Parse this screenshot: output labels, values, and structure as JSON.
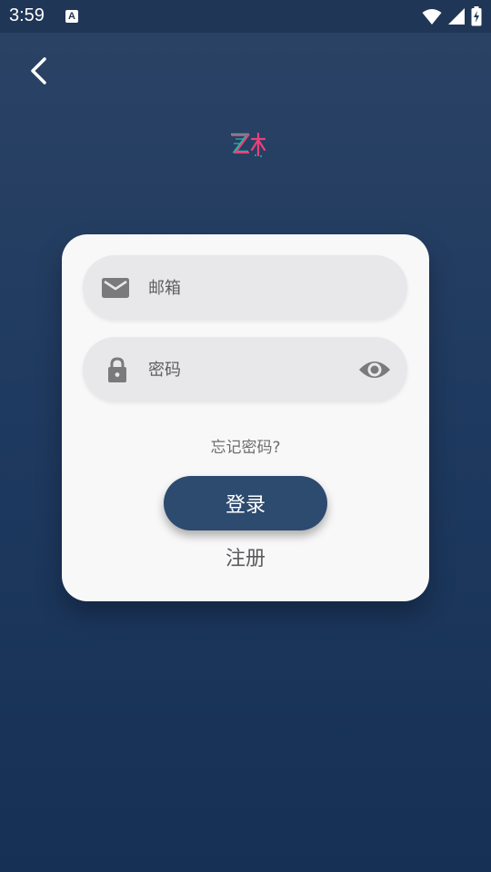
{
  "status_bar": {
    "time": "3:59",
    "notification_badge": "A",
    "icons": [
      "wifi-icon",
      "cellular-signal-icon",
      "battery-charging-icon"
    ]
  },
  "nav": {
    "back_icon": "chevron-left-icon"
  },
  "logo": {
    "colors": [
      "#1fb7a6",
      "#e8417a"
    ]
  },
  "form": {
    "email": {
      "placeholder": "邮箱",
      "value": "",
      "icon": "mail-icon"
    },
    "password": {
      "placeholder": "密码",
      "value": "",
      "icon": "lock-icon",
      "toggle_icon": "eye-icon"
    },
    "forgot_label": "忘记密码?",
    "login_label": "登录",
    "register_label": "注册"
  },
  "colors": {
    "background_top": "#2b4365",
    "background_bottom": "#163055",
    "card": "#f8f8f9",
    "field": "#e8e8ea",
    "primary_button": "#2d4a6f",
    "icon_gray": "#7a7a7d"
  }
}
